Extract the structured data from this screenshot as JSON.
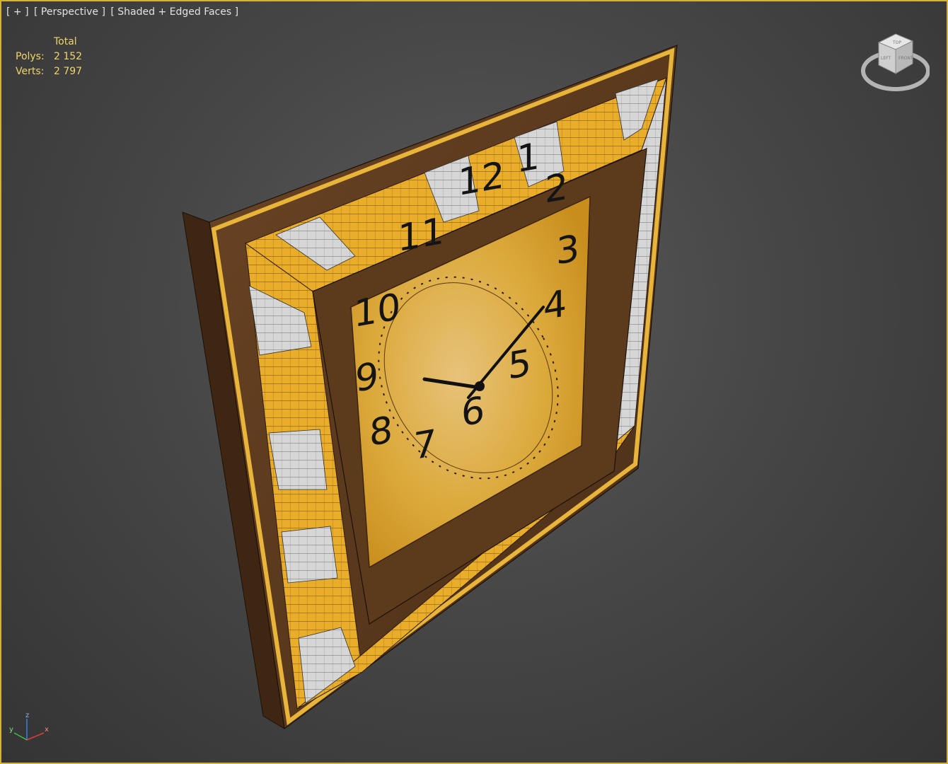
{
  "viewport": {
    "labels": [
      "[ + ]",
      "[ Perspective ]",
      "[ Shaded + Edged Faces ]"
    ],
    "stats": {
      "header": "Total",
      "rows": [
        {
          "label": "Polys:",
          "value": "2 152"
        },
        {
          "label": "Verts:",
          "value": "2 797"
        }
      ]
    },
    "viewcube": {
      "face_top": "TOP",
      "face_left": "LEFT",
      "face_front": "FRONT"
    },
    "axis": {
      "x": "x",
      "y": "y",
      "z": "z"
    }
  },
  "clock": {
    "numerals": [
      "12",
      "1",
      "2",
      "3",
      "4",
      "5",
      "6",
      "7",
      "8",
      "9",
      "10",
      "11"
    ]
  },
  "colors": {
    "frame_border": "#d6b13a",
    "wood": "#5a3a1e",
    "gold": "#e2a82a",
    "dial": "#d8a630",
    "stats_text": "#f0d46a"
  }
}
